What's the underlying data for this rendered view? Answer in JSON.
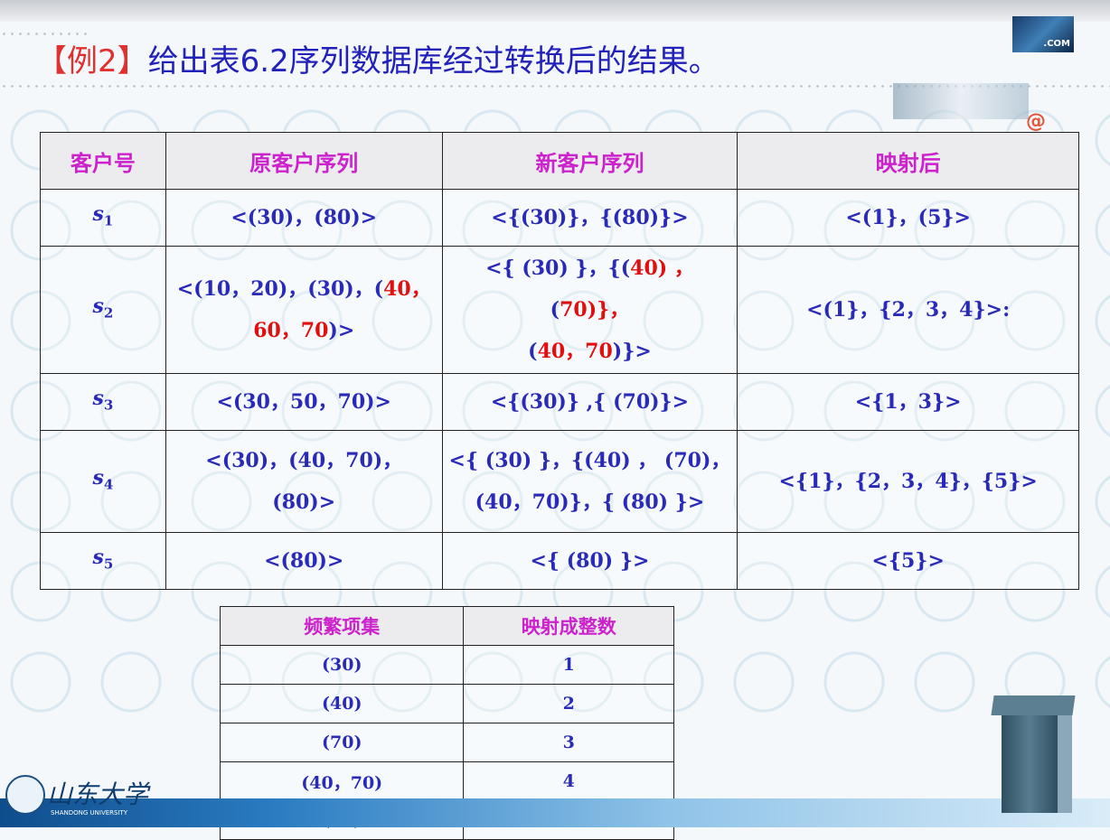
{
  "title": {
    "example_tag": "【例2】",
    "text": "给出表6.2序列数据库经过转换后的结果。"
  },
  "deco": {
    "com_label": ".COM",
    "at_symbol": "@"
  },
  "table1": {
    "headers": [
      "客户号",
      "原客户序列",
      "新客户序列",
      "映射后"
    ],
    "rows": [
      {
        "id": "s",
        "sub": "1",
        "orig": "<(30)，(80)>",
        "new": "<{(30)}，{(80)}>",
        "mapped": "<(1}，(5}>"
      },
      {
        "id": "s",
        "sub": "2",
        "orig_a": "<(10，20)，(30)，(",
        "orig_b": "40，",
        "orig_c": "60，70",
        "orig_d": ")>",
        "orig_sep": "",
        "new_a": "<{ (30) }，{(",
        "new_b": "40",
        "new_c": ") ，",
        "new_d": "(",
        "new_e": "70",
        "new_f": ")}，",
        "new_g": "(",
        "new_h": "40，70",
        "new_i": ")}>",
        "mapped": "<(1}，{2，3，4}>:"
      },
      {
        "id": "s",
        "sub": "3",
        "orig": "<(30，50，70)>",
        "new": "<{(30)} ,{ (70)}>",
        "mapped": "<{1，3}>"
      },
      {
        "id": "s",
        "sub": "4",
        "orig_line1": "<(30)，(40，70)，",
        "orig_line2": "(80)>",
        "new_line1": "<{ (30) }，{(40) ，  (70)，",
        "new_line2": "(40，70)}，{ (80) }>",
        "mapped": "<{1}，{2，3，4}，{5}>"
      },
      {
        "id": "s",
        "sub": "5",
        "orig": "<(80)>",
        "new": "<{ (80) }>",
        "mapped": "<{5}>"
      }
    ]
  },
  "table2": {
    "headers": [
      "频繁项集",
      "映射成整数"
    ],
    "rows": [
      {
        "itemset": "(30)",
        "int": "1"
      },
      {
        "itemset": "(40)",
        "int": "2"
      },
      {
        "itemset": "(70)",
        "int": "3"
      },
      {
        "itemset": "(40，70)",
        "int": "4"
      },
      {
        "itemset": "(80)",
        "int": "5"
      }
    ]
  },
  "footer": {
    "university_name": "山东大学",
    "university_en": "SHANDONG UNIVERSITY"
  },
  "colors": {
    "title": "#2222bb",
    "example_tag": "#e03030",
    "header": "#cc22cc",
    "cell": "#2a2ab8",
    "highlight": "#e01010"
  }
}
